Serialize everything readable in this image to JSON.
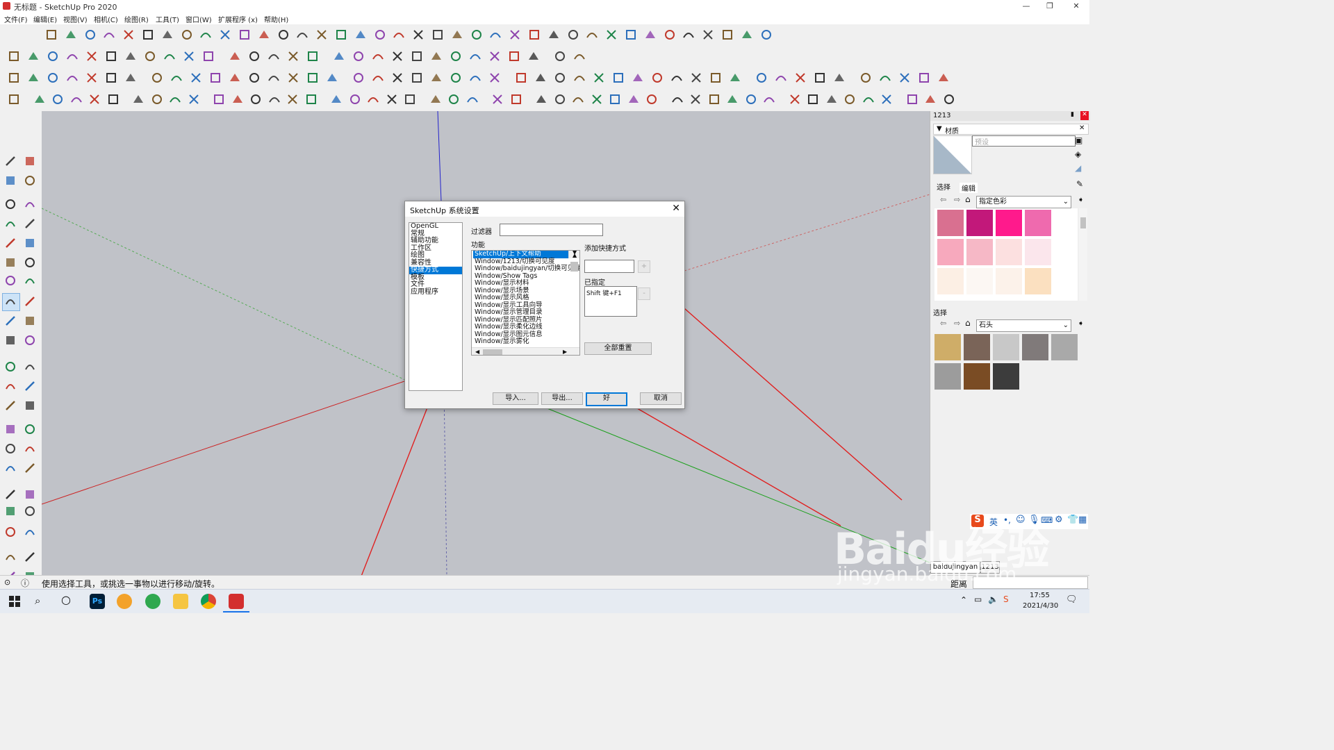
{
  "window": {
    "title": "无标题 - SketchUp Pro 2020",
    "controls": [
      "—",
      "❐",
      "✕"
    ]
  },
  "menu": [
    "文件(F)",
    "编辑(E)",
    "视图(V)",
    "相机(C)",
    "绘图(R)",
    "工具(T)",
    "窗口(W)",
    "扩展程序 (x)",
    "帮助(H)"
  ],
  "dialog": {
    "title": "SketchUp 系统设置",
    "categories": [
      "OpenGL",
      "常规",
      "辅助功能",
      "工作区",
      "绘图",
      "兼容性",
      "快捷方式",
      "模板",
      "文件",
      "应用程序"
    ],
    "selected_category": "快捷方式",
    "filter_label": "过滤器",
    "filter_value": "",
    "function_label": "功能",
    "functions": [
      "SketchUp/上下文帮助",
      "Window/1213/切换可见度",
      "Window/baidujingyan/切换可见度",
      "Window/Show Tags",
      "Window/显示材料",
      "Window/显示场景",
      "Window/显示风格",
      "Window/显示工具向导",
      "Window/显示管理目录",
      "Window/显示匹配照片",
      "Window/显示柔化边线",
      "Window/显示图元信息",
      "Window/显示雾化"
    ],
    "selected_function": "SketchUp/上下文帮助",
    "add_shortcut_label": "添加快捷方式",
    "add_button": "+",
    "assigned_label": "已指定",
    "assigned_value": "Shift 键+F1",
    "remove_button": "-",
    "reset_all": "全部重置",
    "import": "导入...",
    "export": "导出...",
    "ok": "好",
    "cancel": "取消"
  },
  "tray": {
    "header": "1213",
    "materials_title": "材质",
    "preset_placeholder": "预设",
    "tab_select": "选择",
    "tab_edit": "编辑",
    "library1": "指定色彩",
    "section2": "选择",
    "library2": "石头",
    "swatches1": [
      "#d97090",
      "#c2187a",
      "#ff1a8c",
      "#ef6aae",
      "#f7a9bd",
      "#f6b8c6",
      "#fce0e0",
      "#fbe6ec",
      "#fcefe4",
      "#fcf7f3",
      "#fcf2ea",
      "#fbe0c0"
    ],
    "swatches2": [
      "#cfad68",
      "#7a6458",
      "#c8c8c8",
      "#807a7a",
      "#a9a9a9",
      "#9c9c9c",
      "#7a4c24",
      "#3c3c3c"
    ]
  },
  "status": {
    "text": "使用选择工具，或挑选一事物以进行移动/旋转。",
    "distance_label": "距离"
  },
  "ime": {
    "lang": "英"
  },
  "tabs_bottom": {
    "tab1": "baidujingyan",
    "tab2": "1213"
  },
  "taskbar": {
    "time": "17:55",
    "date": "2021/4/30"
  },
  "watermark": {
    "line1": "Baidu经验",
    "line2": "jingyan.baidu.com"
  }
}
